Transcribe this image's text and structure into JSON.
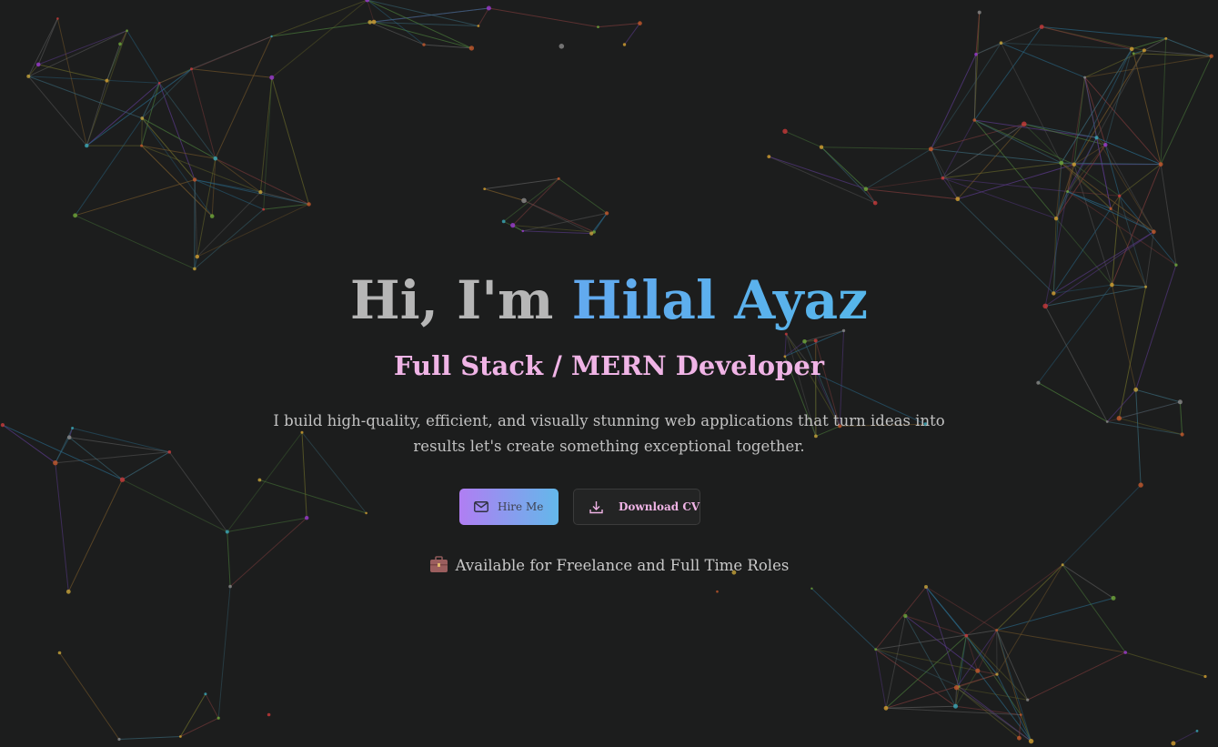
{
  "hero": {
    "greeting_prefix": "Hi, I'm",
    "name": "Hilal Ayaz",
    "role": "Full Stack / MERN Developer",
    "description": "I build high-quality, efficient, and visually stunning web applications that turn ideas into results let's create something exceptional together.",
    "availability": "Available for Freelance and Full Time Roles"
  },
  "buttons": {
    "hire_label": "Hire Me",
    "cv_label": "Download CV"
  },
  "icons": {
    "hire": "mail-icon",
    "cv": "download-icon",
    "availability": "briefcase-icon"
  },
  "colors": {
    "background": "#1c1d1d",
    "name_gradient_start": "#62a9ef",
    "name_gradient_end": "#56b6ea",
    "role": "#f0b4e6",
    "button_gradient_start": "#b07ef3",
    "button_gradient_end": "#63b8ea"
  }
}
